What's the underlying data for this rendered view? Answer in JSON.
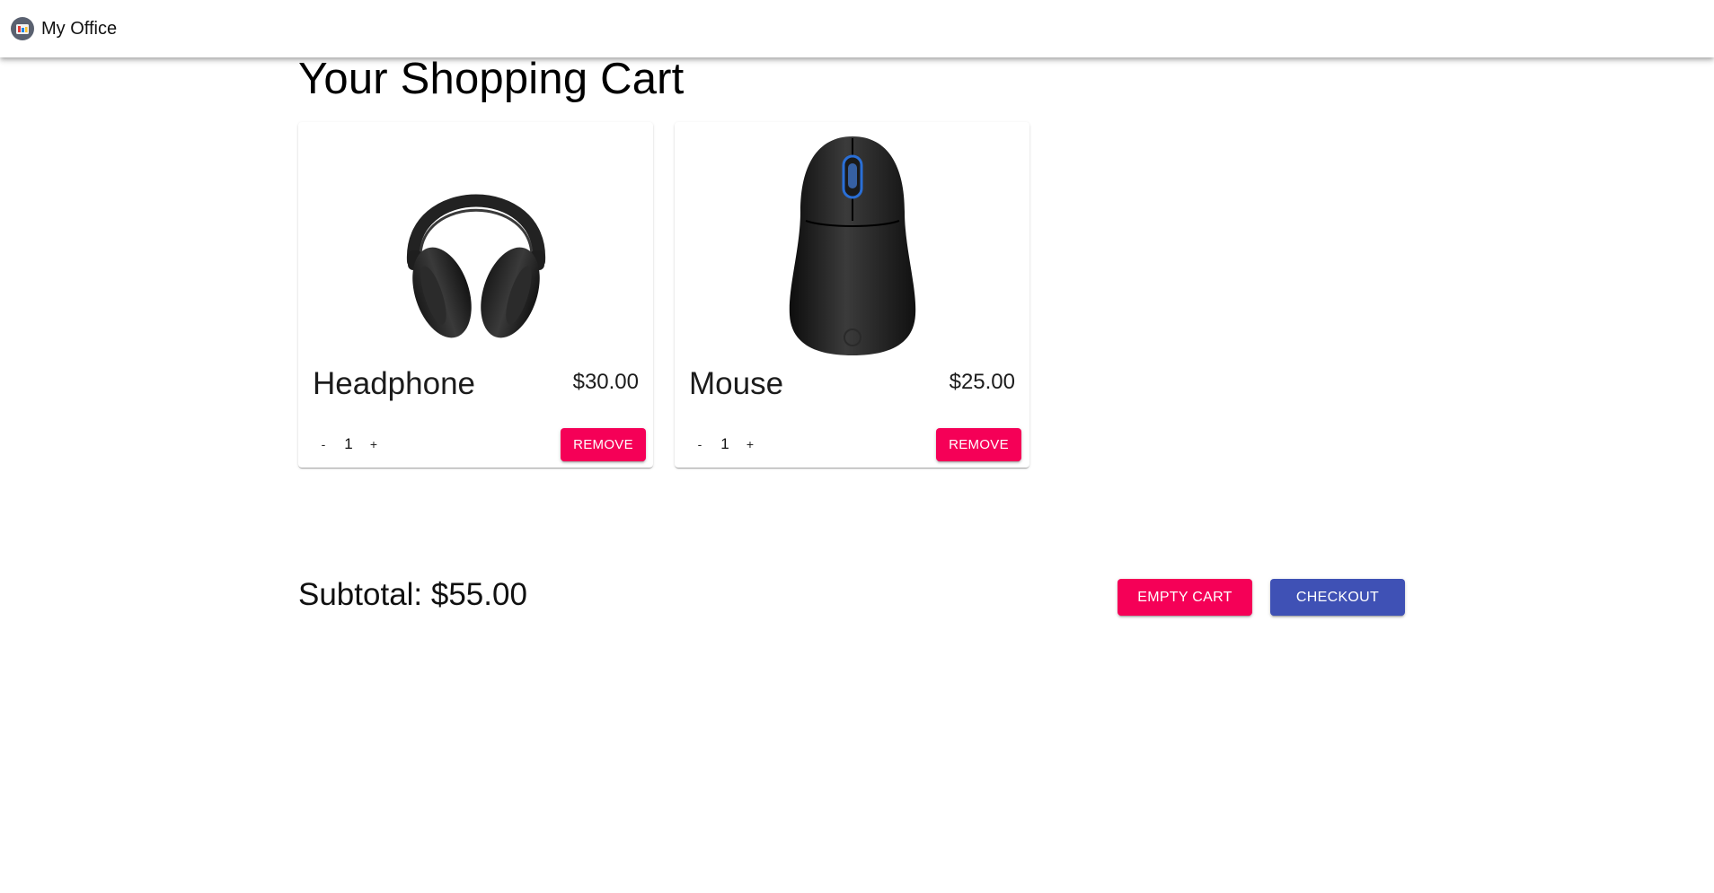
{
  "app": {
    "title": "My Office",
    "logo_icon": "office-logo-icon"
  },
  "page": {
    "title": "Your Shopping Cart"
  },
  "cart": {
    "items": [
      {
        "name": "Headphone",
        "price": "$30.00",
        "quantity": "1",
        "decrement_label": "-",
        "increment_label": "+",
        "remove_label": "REMOVE",
        "image_icon": "headphone-image"
      },
      {
        "name": "Mouse",
        "price": "$25.00",
        "quantity": "1",
        "decrement_label": "-",
        "increment_label": "+",
        "remove_label": "REMOVE",
        "image_icon": "mouse-image"
      }
    ],
    "subtotal": "Subtotal: $55.00",
    "empty_label": "EMPTY CART",
    "checkout_label": "CHECKOUT"
  },
  "colors": {
    "secondary": "#f50057",
    "primary": "#3f51b5"
  }
}
